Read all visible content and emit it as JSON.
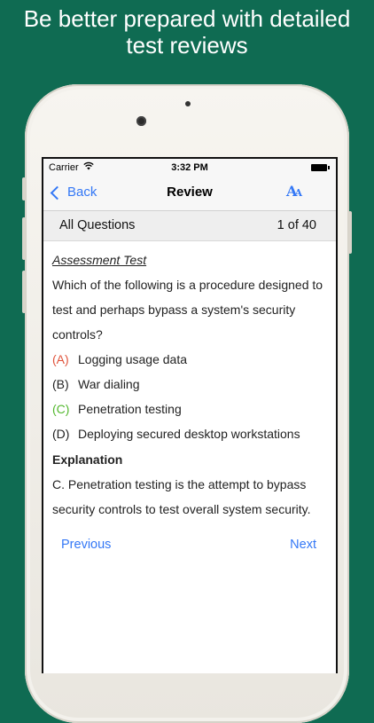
{
  "promo": {
    "line1": "Be better prepared with detailed",
    "line2": "test reviews"
  },
  "status_bar": {
    "carrier": "Carrier",
    "time": "3:32 PM"
  },
  "navbar": {
    "back_label": "Back",
    "title": "Review",
    "font_icon_large": "A",
    "font_icon_small": "A"
  },
  "question_bar": {
    "filter_label": "All Questions",
    "position": "1 of 40"
  },
  "question": {
    "test_name": "Assessment Test",
    "text": "Which of the following is a procedure designed to test and perhaps bypass a system's security controls?",
    "options": [
      {
        "letter": "(A)",
        "text": "Logging usage data",
        "state": "wrong"
      },
      {
        "letter": "(B)",
        "text": "War dialing",
        "state": "normal"
      },
      {
        "letter": "(C)",
        "text": "Penetration testing",
        "state": "correct"
      },
      {
        "letter": "(D)",
        "text": "Deploying secured desktop workstations",
        "state": "normal"
      }
    ],
    "explanation_title": "Explanation",
    "explanation_text": "C. Penetration testing is the attempt to bypass security controls to test overall system security."
  },
  "pager": {
    "previous_label": "Previous",
    "next_label": "Next"
  },
  "colors": {
    "background": "#0f6b52",
    "accent": "#3478f6",
    "wrong": "#e0533b",
    "correct": "#53b82e"
  }
}
